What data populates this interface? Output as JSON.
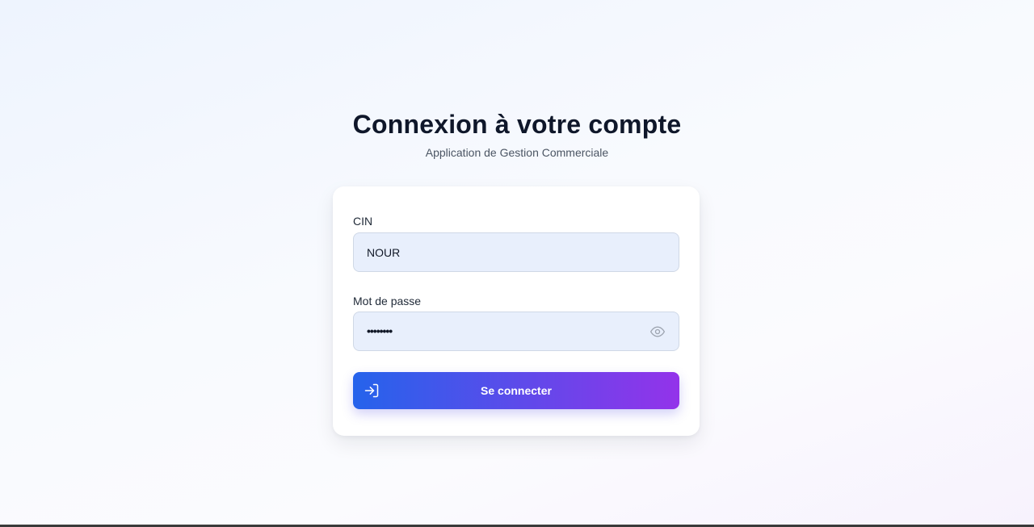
{
  "header": {
    "title": "Connexion à votre compte",
    "subtitle": "Application de Gestion Commerciale"
  },
  "form": {
    "cin": {
      "label": "CIN",
      "value": "NOUR"
    },
    "password": {
      "label": "Mot de passe",
      "masked_value": "••••••••",
      "toggle_icon": "eye-icon"
    },
    "submit": {
      "label": "Se connecter",
      "icon": "login-icon"
    }
  },
  "colors": {
    "button_gradient_start": "#2563eb",
    "button_gradient_end": "#9333ea",
    "input_background": "#e8effc",
    "title_color": "#0f172a"
  }
}
